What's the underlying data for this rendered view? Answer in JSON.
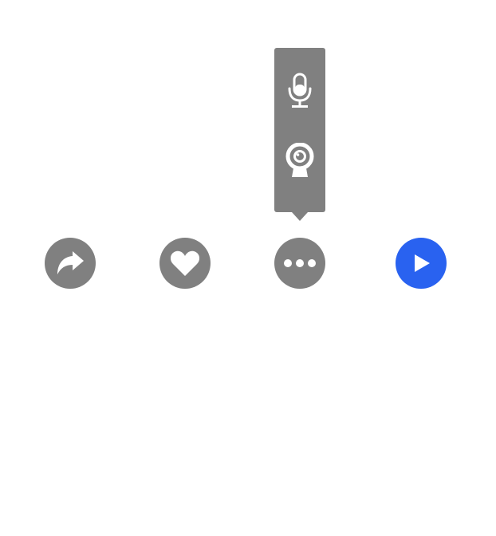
{
  "colors": {
    "button_gray": "#808080",
    "popover_bg": "#808080",
    "icon_fill": "#ffffff",
    "play_blue": "#2962f0"
  },
  "popover": {
    "items": [
      {
        "icon": "microphone-icon"
      },
      {
        "icon": "webcam-icon"
      }
    ]
  },
  "action_bar": {
    "buttons": [
      {
        "icon": "share-arrow-icon"
      },
      {
        "icon": "heart-icon"
      },
      {
        "icon": "ellipsis-icon"
      },
      {
        "icon": "play-icon"
      }
    ]
  }
}
